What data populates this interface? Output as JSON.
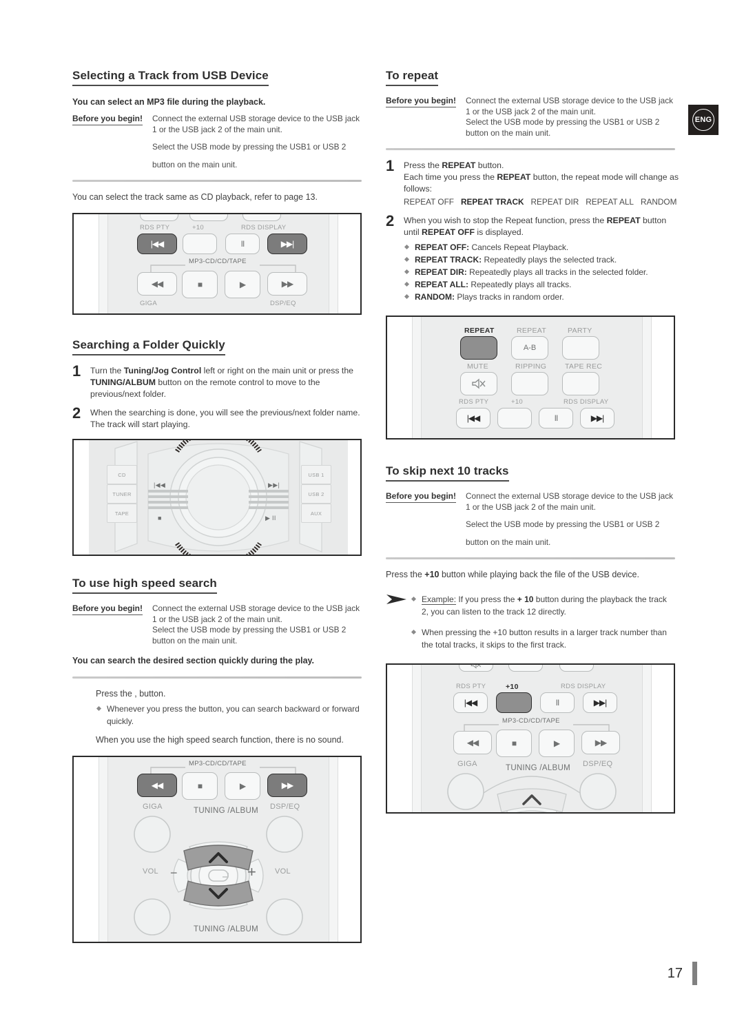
{
  "page": {
    "number": "17",
    "language_badge": "ENG"
  },
  "before_you_begin": {
    "label": "Before you begin!",
    "line1": "Connect the external USB storage device to the USB jack",
    "line2": "1 or the USB jack 2 of the main unit.",
    "line3": "Select the USB mode by pressing the USB1 or USB 2",
    "line4": "button on the main unit."
  },
  "left": {
    "section1": {
      "heading": "Selecting a Track from USB Device",
      "intro": "You can select an MP3 file during the playback.",
      "after_rule": "You can select the track same as CD playback, refer to page 13."
    },
    "section2": {
      "heading": "Searching a Folder Quickly",
      "steps": [
        {
          "num": "1",
          "t1": "Turn the ",
          "b1": "Tuning/Jog Control",
          "t2": " left or right on the main unit or press the ",
          "b2": "TUNING/ALBUM",
          "t3": " button on the remote control to move to the previous/next folder."
        },
        {
          "num": "2",
          "t1": "When the searching is done, you will see the previous/next folder name. The track will start playing.",
          "b1": "",
          "t2": "",
          "b2": "",
          "t3": ""
        }
      ]
    },
    "section3": {
      "heading": "To use high speed search",
      "bold_note": "You can search the desired section quickly during the play.",
      "press_line": "Press the ,      button.",
      "bullet1": "Whenever you press the button, you can search backward or forward quickly.",
      "closing": "When you use the high speed search function, there is no sound."
    }
  },
  "right": {
    "section1": {
      "heading": "To repeat",
      "step1": {
        "num": "1",
        "t1": "Press the ",
        "b1": "REPEAT",
        "t2": " button.",
        "t3": "Each time you press the ",
        "b2": "REPEAT",
        "t4": " button, the repeat mode will change as follows:"
      },
      "modes": [
        {
          "label": "REPEAT OFF",
          "active": false
        },
        {
          "label": "REPEAT TRACK",
          "active": true
        },
        {
          "label": "REPEAT DIR",
          "active": false
        },
        {
          "label": "REPEAT ALL",
          "active": false
        },
        {
          "label": "RANDOM",
          "active": false
        }
      ],
      "step2": {
        "num": "2",
        "t1": "When you wish to stop the Repeat function, press the ",
        "b1": "REPEAT",
        "t2": " button until ",
        "b2": "REPEAT OFF",
        "t3": " is displayed."
      },
      "bullets": [
        {
          "term": "REPEAT OFF:",
          "desc": " Cancels Repeat Playback."
        },
        {
          "term": "REPEAT TRACK:",
          "desc": " Repeatedly plays the selected track."
        },
        {
          "term": "REPEAT DIR:",
          "desc": " Repeatedly plays all tracks in the selected folder."
        },
        {
          "term": "REPEAT ALL:",
          "desc": " Repeatedly plays all tracks."
        },
        {
          "term": "RANDOM:",
          "desc": " Plays tracks in random order."
        }
      ]
    },
    "section2": {
      "heading": "To skip next 10 tracks",
      "press_t1": "Press the ",
      "press_b": "+10",
      "press_t2": " button while playing back the file of the USB device.",
      "note": {
        "term": "Example:",
        "t1": " If you press the ",
        "b1": "+ 10",
        "t2": " button during the playback the track 2, you can listen to the track 12 directly.",
        "bullet2": "When pressing the +10 button results in a larger track number than the total tracks, it skips to the first track."
      }
    }
  },
  "figures": {
    "fig1_remote_skip": {
      "name": "remote-transport-buttons",
      "labels": {
        "rds_pty": "RDS PTY",
        "plus10": "+10",
        "rds_display": "RDS DISPLAY",
        "mp3_group": "MP3-CD/CD/TAPE",
        "giga": "GIGA",
        "dspeq": "DSP/EQ"
      },
      "buttons": {
        "prev": "|◀◀",
        "pause": "II",
        "next": "▶▶|",
        "rew": "◀◀",
        "stop": "■",
        "play": "▶",
        "ff": "▶▶"
      }
    },
    "fig2_main_unit": {
      "name": "main-unit-jog-control",
      "left_buttons": [
        "CD",
        "TUNER",
        "TAPE"
      ],
      "right_buttons": [
        "USB 1",
        "USB 2",
        "AUX"
      ],
      "center_buttons": {
        "prev": "|◀◀",
        "next": "▶▶|",
        "stop": "■",
        "playpause": "▶ II"
      }
    },
    "fig3_remote_search": {
      "name": "remote-search-and-tuning",
      "labels": {
        "mp3_group": "MP3-CD/CD/TAPE",
        "giga": "GIGA",
        "dspeq": "DSP/EQ",
        "tuning_top": "TUNING /ALBUM",
        "tuning_bottom": "TUNING /ALBUM",
        "vol_left": "VOL",
        "vol_right": "VOL"
      },
      "buttons": {
        "rew": "◀◀",
        "stop": "■",
        "play": "▶",
        "ff": "▶▶",
        "up": "⌃",
        "down": "⌄",
        "minus": "−",
        "plus": "+"
      }
    },
    "fig4_remote_repeat": {
      "name": "remote-repeat-buttons",
      "labels": {
        "repeat": "REPEAT",
        "repeat_ab": "REPEAT",
        "ab": "A-B",
        "party": "PARTY",
        "mute": "MUTE",
        "ripping": "RIPPING",
        "tape_rec": "TAPE REC",
        "rds_pty": "RDS PTY",
        "plus10": "+10",
        "rds_display": "RDS DISPLAY"
      },
      "buttons": {
        "prev": "|◀◀",
        "pause": "II",
        "next": "▶▶|"
      }
    },
    "fig5_remote_plus10": {
      "name": "remote-plus10-button",
      "labels": {
        "rds_pty": "RDS PTY",
        "plus10": "+10",
        "rds_display": "RDS DISPLAY",
        "mp3_group": "MP3-CD/CD/TAPE",
        "giga": "GIGA",
        "dspeq": "DSP/EQ",
        "tuning": "TUNING /ALBUM"
      },
      "buttons": {
        "prev": "|◀◀",
        "pause": "II",
        "next": "▶▶|",
        "rew": "◀◀",
        "stop": "■",
        "play": "▶",
        "ff": "▶▶",
        "up": "⌃"
      }
    }
  },
  "colors": {
    "ink": "#3a3a3a",
    "heading": "#2f2f2f",
    "rule": "#c4c4c4",
    "badge_bg": "#231f1d",
    "btn_dark": "#7c7c7c"
  }
}
